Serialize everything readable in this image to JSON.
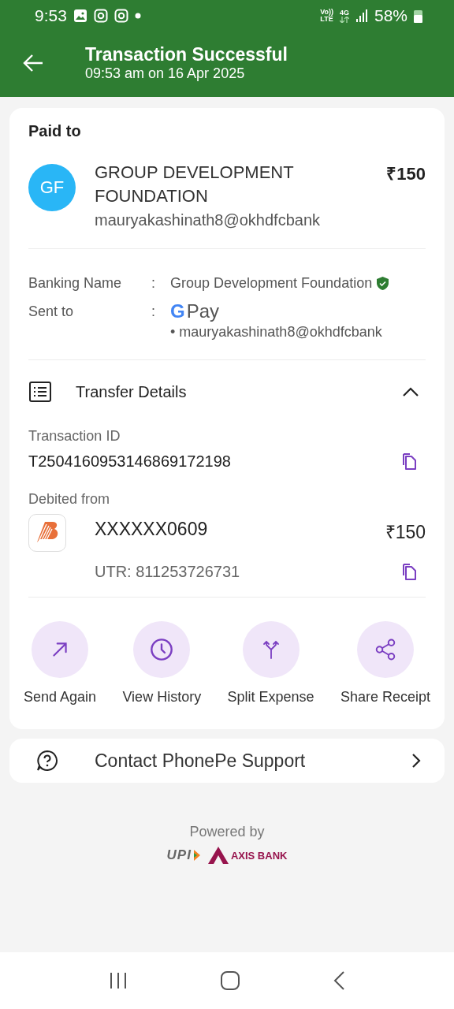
{
  "status_bar": {
    "time": "9:53",
    "volte": "Vo))",
    "lte": "LTE",
    "network": "4G",
    "battery": "58%"
  },
  "header": {
    "title": "Transaction Successful",
    "subtitle": "09:53 am on 16 Apr 2025"
  },
  "paid_to": {
    "label": "Paid to",
    "initials": "GF",
    "name": "GROUP DEVELOPMENT FOUNDATION",
    "upi_id": "mauryakashinath8@okhdfcbank",
    "amount": "₹150"
  },
  "details": [
    {
      "label": "Banking Name",
      "separator": ":",
      "value": "Group Development Foundation",
      "verified": true
    },
    {
      "label": "Sent to",
      "separator": ":",
      "app_letter": "G",
      "app_name": "Pay",
      "value": "• mauryakashinath8@okhdfcbank"
    }
  ],
  "transfer_details": {
    "title": "Transfer Details",
    "expanded": true,
    "transaction_id_label": "Transaction ID",
    "transaction_id": "T2504160953146869172198",
    "debited_label": "Debited from",
    "account": "XXXXXX0609",
    "amount": "₹150",
    "utr": "UTR: 811253726731"
  },
  "actions": [
    {
      "kind": "send",
      "label": "Send Again"
    },
    {
      "kind": "history",
      "label": "View History"
    },
    {
      "kind": "split",
      "label": "Split Expense"
    },
    {
      "kind": "share",
      "label": "Share Receipt"
    }
  ],
  "support": {
    "label": "Contact PhonePe Support"
  },
  "footer": {
    "powered_by": "Powered by",
    "logos": [
      "UPI",
      "AXIS BANK"
    ]
  }
}
